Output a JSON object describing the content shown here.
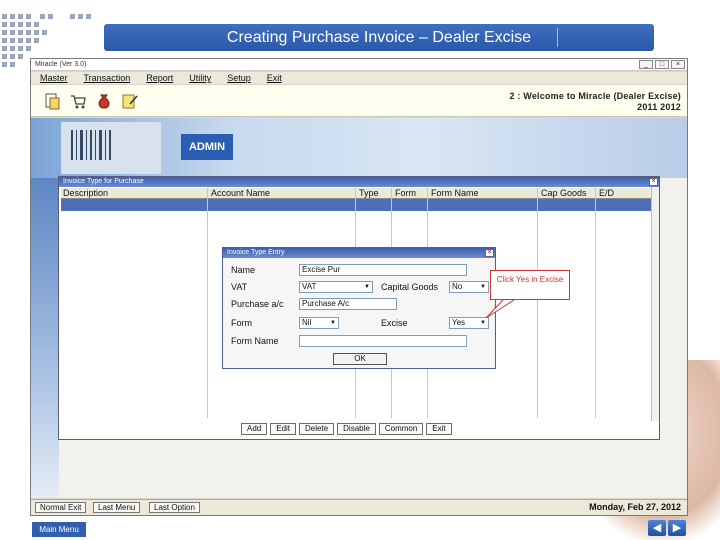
{
  "slide": {
    "title": "Creating Purchase Invoice – Dealer Excise",
    "main_menu": "Main Menu",
    "prev_icon": "arrow-left-icon",
    "next_icon": "arrow-right-icon"
  },
  "app": {
    "window_title": "Miracle (Ver 3.0)",
    "menu": [
      "Master",
      "Transaction",
      "Report",
      "Utility",
      "Setup",
      "Exit"
    ],
    "welcome_line1": "2 : Welcome to Miracle (Dealer Excise)",
    "welcome_line2": "2011  2012",
    "banner_badge": "ADMIN",
    "toolbar_icons": [
      "document-icon",
      "cart-icon",
      "money-bag-icon",
      "edit-note-icon"
    ],
    "status_buttons": [
      "Normal Exit",
      "Last Menu",
      "Last Option"
    ],
    "status_date": "Monday, Feb 27, 2012"
  },
  "invoice_type_window": {
    "title": "Invoice Type for Purchase",
    "columns": [
      "Description",
      "Account Name",
      "Type",
      "Form",
      "Form Name",
      "Cap Goods",
      "E/D"
    ],
    "buttons": [
      "Add",
      "Edit",
      "Delete",
      "Disable",
      "Common",
      "Exit"
    ]
  },
  "entry_dialog": {
    "title": "Invoice Type Entry",
    "name_label": "Name",
    "name_value": "Excise Pur",
    "vat_label": "VAT",
    "vat_value": "VAT",
    "capital_goods_label": "Capital Goods",
    "capital_goods_value": "No",
    "purchase_ac_label": "Purchase a/c",
    "purchase_ac_value": "Purchase A/c",
    "form_label": "Form",
    "form_value": "Nil",
    "excise_label": "Excise",
    "excise_value": "Yes",
    "form_name_label": "Form Name",
    "form_name_value": "",
    "ok_label": "OK"
  },
  "callout": {
    "text": "Click Yes in Excise"
  }
}
